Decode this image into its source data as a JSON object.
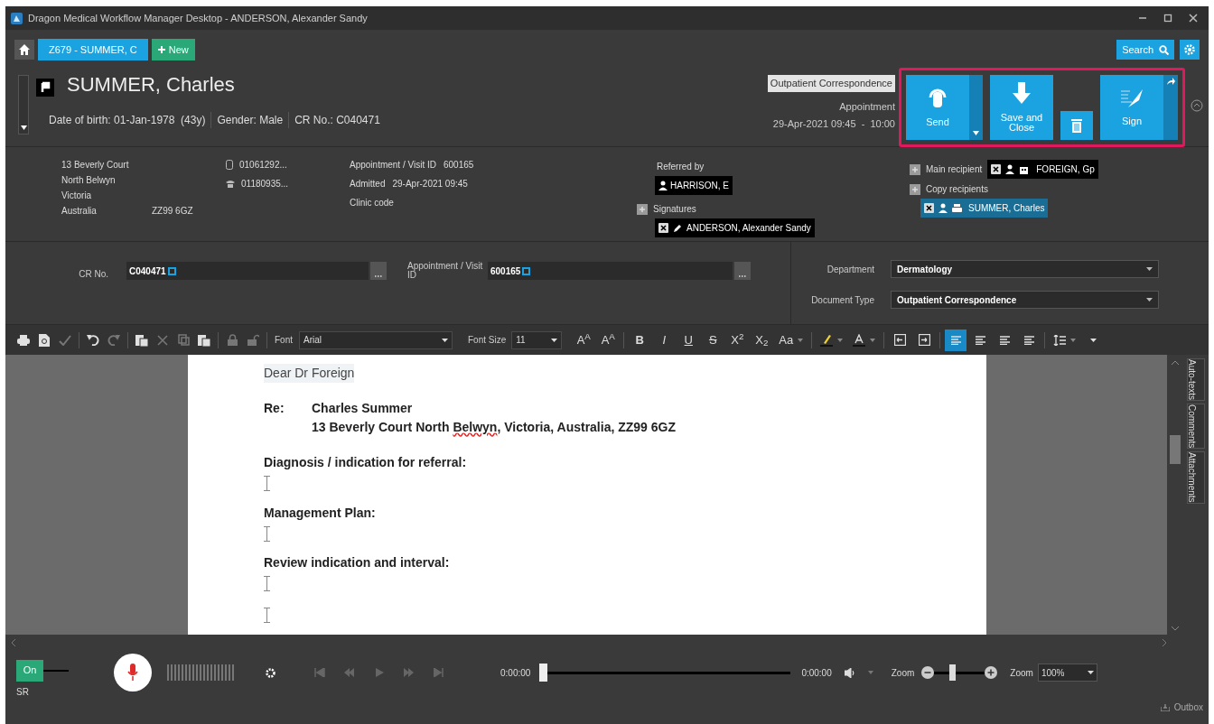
{
  "window": {
    "title": "Dragon Medical Workflow Manager Desktop - ANDERSON, Alexander Sandy"
  },
  "tabs": [
    {
      "label": "Z679 - SUMMER, C",
      "selected": true
    }
  ],
  "new_button": "New",
  "search_button": "Search",
  "patient": {
    "name": "SUMMER, Charles",
    "details": [
      "Date of birth: 01-Jan-1978  (43y)",
      "Gender: Male",
      "CR No.: C040471"
    ]
  },
  "document_badge": "Outpatient Correspondence",
  "appointment": {
    "label": "Appointment",
    "time": "29-Apr-2021 09:45  -  10:00"
  },
  "actions": [
    {
      "kind": "send",
      "label": "Send"
    },
    {
      "kind": "save",
      "label": "Save and Close"
    },
    {
      "kind": "delete"
    },
    {
      "kind": "sign",
      "label": "Sign"
    }
  ],
  "address": [
    {
      "line": "13 Beverly Court"
    },
    {
      "line": "North Belwyn"
    },
    {
      "line": "Victoria"
    },
    {
      "line": "Australia",
      "postcode": "ZZ99 6GZ"
    }
  ],
  "phones": [
    {
      "kind": "mobile",
      "number": "01061292..."
    },
    {
      "kind": "landline",
      "number": "01180935..."
    }
  ],
  "visit": [
    {
      "label": "Appointment / Visit ID",
      "value": "600165"
    },
    {
      "label": "Admitted",
      "value": "29-Apr-2021 09:45"
    },
    {
      "label": "Clinic code"
    }
  ],
  "referred_by": {
    "label": "Referred by",
    "name": "HARRISON, E"
  },
  "signatures": {
    "label": "Signatures",
    "name": "ANDERSON, Alexander Sandy"
  },
  "main_recipient": {
    "label": "Main recipient",
    "name": "FOREIGN, Gp"
  },
  "copy_recipients": {
    "label": "Copy recipients",
    "name": "SUMMER, Charles"
  },
  "form": {
    "cr_label": "CR No.",
    "cr_value": "C040471",
    "visit_label": "Appointment / Visit ID",
    "visit_value": "600165",
    "department_label": "Department",
    "department": "Dermatology",
    "doctype_label": "Document Type",
    "doctype": "Outpatient Correspondence"
  },
  "toolbar": {
    "font_label": "Font",
    "font": "Arial",
    "size_label": "Font Size",
    "size": "11",
    "tools": [
      {
        "kind": "print",
        "disabled": false
      },
      {
        "kind": "preview",
        "disabled": false
      },
      {
        "kind": "spellcheck",
        "disabled": true
      },
      {
        "kind": "undo",
        "disabled": false
      },
      {
        "kind": "redo",
        "disabled": true
      },
      {
        "kind": "paste",
        "disabled": false
      },
      {
        "kind": "cut",
        "disabled": true
      },
      {
        "kind": "copy",
        "disabled": true
      },
      {
        "kind": "paste",
        "disabled": false
      },
      {
        "kind": "lock",
        "disabled": true
      },
      {
        "kind": "unlock",
        "disabled": true
      }
    ],
    "format": [
      {
        "kind": "text",
        "label": "A$^{A}$"
      },
      {
        "kind": "text",
        "label": "A$^{A}$"
      },
      {
        "kind": "bold",
        "label": "B"
      },
      {
        "kind": "italic",
        "label": "I"
      },
      {
        "kind": "underline",
        "label": "U"
      },
      {
        "kind": "strike",
        "label": "S"
      },
      {
        "kind": "text",
        "label": "X$^{2}$"
      },
      {
        "kind": "text",
        "label": "X$_{2}$"
      },
      {
        "kind": "text",
        "label": "Aa",
        "dropdown": true
      },
      {
        "kind": "highlight",
        "dropdown": true
      },
      {
        "kind": "fontcolor",
        "dropdown": true
      },
      {
        "kind": "outdent"
      },
      {
        "kind": "indent"
      },
      {
        "kind": "align",
        "selected": true
      },
      {
        "kind": "align",
        "selected": false
      },
      {
        "kind": "align",
        "selected": false
      },
      {
        "kind": "align",
        "selected": false
      },
      {
        "kind": "spacing",
        "dropdown": true
      },
      {
        "kind": "more"
      }
    ]
  },
  "document": [
    {
      "kind": "greeting",
      "text": "Dear Dr Foreign"
    },
    {
      "kind": "re",
      "label": "Re:",
      "lines": [
        [
          {
            "text": "Charles Summer"
          }
        ],
        [
          {
            "text": "13 Beverly Court North "
          },
          {
            "text": "Belwyn",
            "misspelled": true
          },
          {
            "text": ", Victoria, Australia, ZZ99 6GZ"
          }
        ]
      ]
    },
    {
      "kind": "heading",
      "text": "Diagnosis / indication for referral:"
    },
    {
      "kind": "cursor"
    },
    {
      "kind": "heading",
      "text": "Management Plan:"
    },
    {
      "kind": "cursor"
    },
    {
      "kind": "heading",
      "text": "Review indication and interval:"
    },
    {
      "kind": "cursor"
    },
    {
      "kind": "cursor"
    }
  ],
  "side_tabs": [
    "Auto-texts",
    "Comments",
    "Attachments"
  ],
  "bottom": {
    "sr_toggle": {
      "label": "On",
      "on": true
    },
    "sr_label": "SR",
    "transport": [
      {
        "kind": "start",
        "disabled": true
      },
      {
        "kind": "rewind",
        "disabled": true
      },
      {
        "kind": "play",
        "disabled": true
      },
      {
        "kind": "forward",
        "disabled": true
      },
      {
        "kind": "end",
        "disabled": true
      }
    ],
    "position": {
      "start": "0:00:00",
      "end": "0:00:00",
      "level": 0
    },
    "zoom_label": "Zoom",
    "zoom_slider": {
      "level": 0.35
    },
    "zoom_label_2": "Zoom",
    "zoom_value": "100%",
    "outbox": "Outbox"
  }
}
